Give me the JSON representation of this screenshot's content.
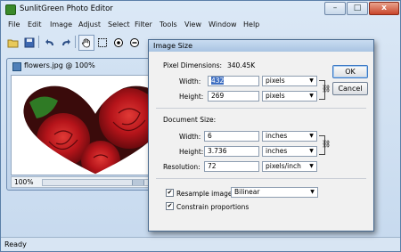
{
  "app": {
    "title": "SunlitGreen Photo Editor",
    "window_controls": {
      "minimize": "–",
      "maximize": "□",
      "close": "x"
    }
  },
  "menu": [
    "File",
    "Edit",
    "Image",
    "Adjust",
    "Select",
    "Filter",
    "Tools",
    "View",
    "Window",
    "Help"
  ],
  "toolbar": {
    "tools": [
      "open-icon",
      "save-icon",
      "undo-icon",
      "redo-icon",
      "hand-icon",
      "marquee-icon",
      "zoom-in-icon",
      "zoom-out-icon"
    ]
  },
  "document": {
    "title": "flowers.jpg @ 100%",
    "zoom": "100%"
  },
  "status": {
    "text": "Ready"
  },
  "dialog": {
    "title": "Image Size",
    "pixel_dimensions_label": "Pixel Dimensions:",
    "pixel_dimensions_value": "340.45K",
    "width_label": "Width:",
    "height_label": "Height:",
    "pixel_width": "432",
    "pixel_height": "269",
    "pixel_unit": "pixels",
    "document_size_label": "Document Size:",
    "doc_width": "6",
    "doc_height": "3.736",
    "doc_unit": "inches",
    "resolution_label": "Resolution:",
    "resolution": "72",
    "resolution_unit": "pixels/inch",
    "resample_label": "Resample image:",
    "resample_checked": true,
    "resample_method": "Bilinear",
    "constrain_label": "Constrain proportions",
    "constrain_checked": true,
    "ok_label": "OK",
    "cancel_label": "Cancel"
  },
  "colors": {
    "accent": "#3f6fc2",
    "rose_red": "#c4121a",
    "leaf_green": "#2f7a25"
  }
}
